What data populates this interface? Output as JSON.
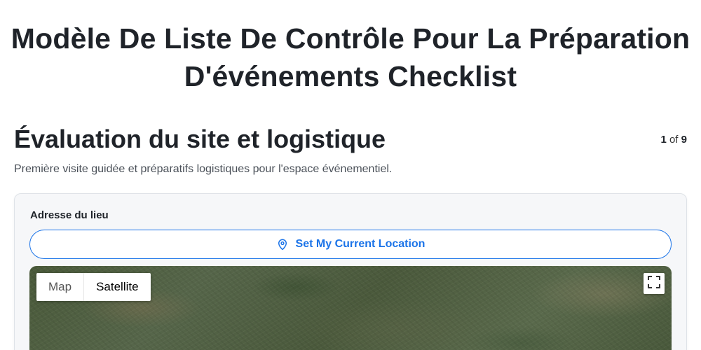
{
  "page": {
    "title": "Modèle De Liste De Contrôle Pour La Préparation D'événements Checklist"
  },
  "section": {
    "title": "Évaluation du site et logistique",
    "description": "Première visite guidée et préparatifs logistiques pour l'espace événementiel.",
    "pager": {
      "current": "1",
      "separator": "of",
      "total": "9"
    }
  },
  "field": {
    "label": "Adresse du lieu",
    "location_button_label": "Set My Current Location",
    "location_icon": "map-pin-icon"
  },
  "map": {
    "type_options": [
      "Map",
      "Satellite"
    ],
    "selected_type": "Satellite",
    "fullscreen_icon": "fullscreen-icon"
  },
  "colors": {
    "accent": "#1a73e8",
    "card_background": "#f6f7f9",
    "title_text": "#1f2329"
  }
}
